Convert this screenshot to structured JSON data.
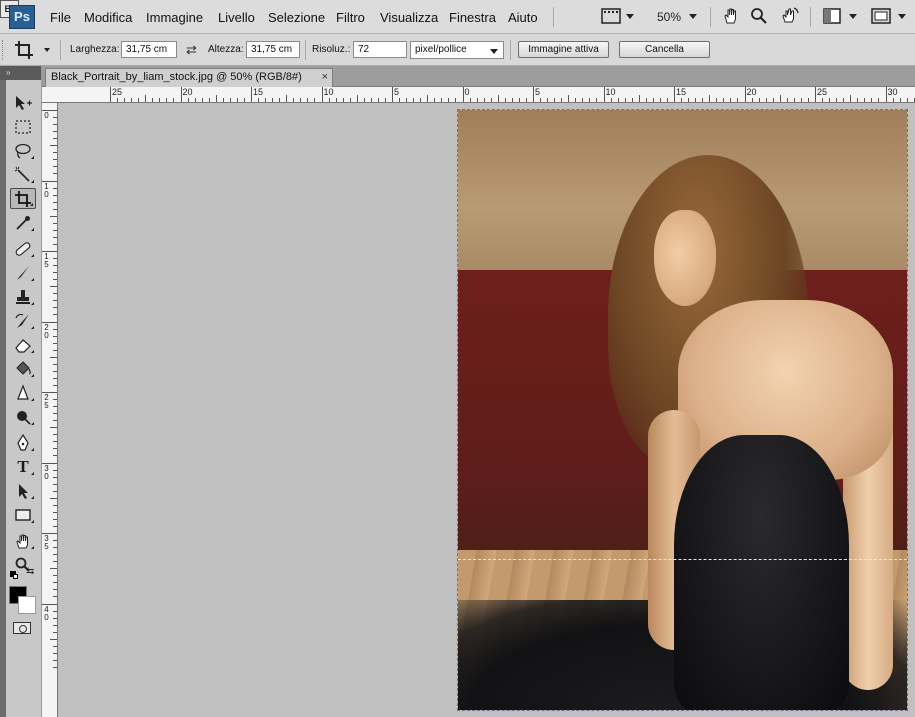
{
  "app": {
    "logo_text": "Ps"
  },
  "menu": {
    "items": [
      "File",
      "Modifica",
      "Immagine",
      "Livello",
      "Selezione",
      "Filtro",
      "Visualizza",
      "Finestra",
      "Aiuto"
    ],
    "bridge_label": "Br",
    "zoom_value": "50%"
  },
  "options": {
    "width_label": "Larghezza:",
    "width_value": "31,75 cm",
    "height_label": "Altezza:",
    "height_value": "31,75 cm",
    "resolution_label": "Risoluz.:",
    "resolution_value": "72",
    "resolution_unit": "pixel/pollice",
    "front_image_label": "Immagine attiva",
    "clear_label": "Cancella"
  },
  "document": {
    "tab_title": "Black_Portrait_by_liam_stock.jpg @ 50% (RGB/8#)",
    "close_glyph": "×"
  },
  "ruler": {
    "top_labels": [
      "25",
      "20",
      "15",
      "10",
      "5",
      "0",
      "5",
      "10",
      "15",
      "20",
      "25",
      "30"
    ],
    "left_labels": [
      "0",
      "5",
      "1",
      "0",
      "1",
      "5",
      "2",
      "0",
      "2",
      "5",
      "3",
      "0",
      "3",
      "5",
      "4",
      "0"
    ]
  },
  "colors": {
    "foreground": "#000000",
    "background": "#ffffff"
  },
  "tools": [
    {
      "name": "move-tool",
      "icon": "move-icon"
    },
    {
      "name": "marquee-tool",
      "icon": "marquee-icon"
    },
    {
      "name": "lasso-tool",
      "icon": "lasso-icon"
    },
    {
      "name": "quick-selection-tool",
      "icon": "magic-wand-icon"
    },
    {
      "name": "crop-tool",
      "icon": "crop-icon"
    },
    {
      "name": "eyedropper-tool",
      "icon": "eyedropper-icon"
    },
    {
      "name": "healing-brush-tool",
      "icon": "bandage-icon"
    },
    {
      "name": "brush-tool",
      "icon": "brush-icon"
    },
    {
      "name": "clone-stamp-tool",
      "icon": "stamp-icon"
    },
    {
      "name": "history-brush-tool",
      "icon": "history-brush-icon"
    },
    {
      "name": "eraser-tool",
      "icon": "eraser-icon"
    },
    {
      "name": "paint-bucket-tool",
      "icon": "paint-bucket-icon"
    },
    {
      "name": "blur-tool",
      "icon": "blur-icon"
    },
    {
      "name": "dodge-tool",
      "icon": "dodge-icon"
    },
    {
      "name": "pen-tool",
      "icon": "pen-icon"
    },
    {
      "name": "type-tool",
      "icon": "type-icon"
    },
    {
      "name": "path-selection-tool",
      "icon": "arrow-icon"
    },
    {
      "name": "shape-tool",
      "icon": "rectangle-icon"
    },
    {
      "name": "hand-tool",
      "icon": "hand-icon"
    },
    {
      "name": "zoom-tool",
      "icon": "zoom-icon"
    }
  ]
}
